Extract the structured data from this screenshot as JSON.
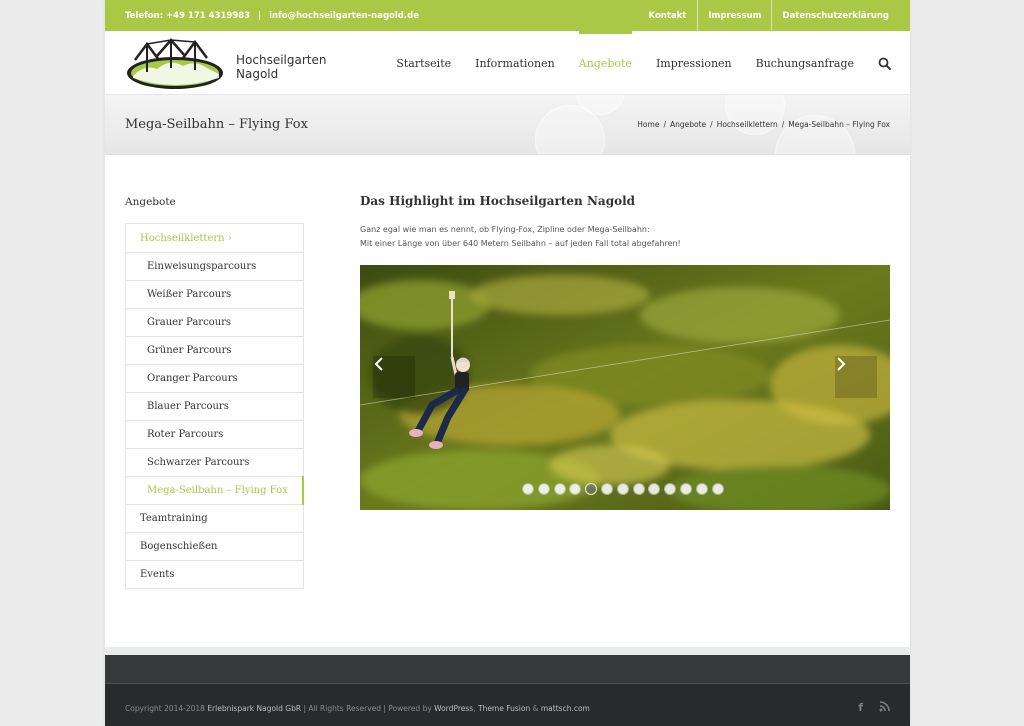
{
  "topbar": {
    "phone": "Telefon: +49 171 4319983",
    "separator": "|",
    "email": "info@hochseilgarten-nagold.de",
    "links": [
      "Kontakt",
      "Impressum",
      "Datenschutzerklärung"
    ]
  },
  "logo": {
    "line1": "Hochseilgarten",
    "line2": "Nagold"
  },
  "nav": {
    "items": [
      "Startseite",
      "Informationen",
      "Angebote",
      "Impressionen",
      "Buchungsanfrage"
    ],
    "active": "Angebote",
    "search_icon": "search-icon"
  },
  "title": {
    "page_title": "Mega-Seilbahn – Flying Fox",
    "breadcrumb": [
      "Home",
      "Angebote",
      "Hochseilklettern",
      "Mega-Seilbahn – Flying Fox"
    ],
    "breadcrumb_sep": "/"
  },
  "sidebar": {
    "heading": "Angebote",
    "items": [
      {
        "label": "Hochseilklettern ›"
      },
      {
        "label": "Einweisungsparcours"
      },
      {
        "label": "Weißer Parcours"
      },
      {
        "label": "Grauer Parcours"
      },
      {
        "label": "Grüner Parcours"
      },
      {
        "label": "Oranger Parcours"
      },
      {
        "label": "Blauer Parcours"
      },
      {
        "label": "Roter Parcours"
      },
      {
        "label": "Schwarzer Parcours"
      },
      {
        "label": "Mega-Seilbahn – Flying Fox"
      },
      {
        "label": "Teamtraining"
      },
      {
        "label": "Bogenschießen"
      },
      {
        "label": "Events"
      }
    ]
  },
  "content": {
    "heading": "Das Highlight im Hochseilgarten Nagold",
    "intro_line1": "Ganz egal wie man es nennt, ob Flying-Fox, Zipline oder Mega-Seilbahn:",
    "intro_line2": "Mit einer Länge von über 640 Metern Seilbahn – auf jeden Fall total abgefahren!"
  },
  "slider": {
    "slide_count": 13,
    "active_slide": 5,
    "prev_icon": "chevron-left-icon",
    "next_icon": "chevron-right-icon"
  },
  "footer": {
    "copyright_prefix": "Copyright 2014-2018",
    "company": "Erlebnispark Nagold GbR",
    "rights": "| All Rights Reserved | Powered by",
    "wordpress": "WordPress",
    "comma": ",",
    "theme": "Theme Fusion",
    "amp": "&",
    "mattsch": "mattsch.com",
    "social": [
      "facebook-icon",
      "rss-icon"
    ]
  },
  "colors": {
    "accent": "#a8c846",
    "footer_dark": "#282a2b"
  }
}
